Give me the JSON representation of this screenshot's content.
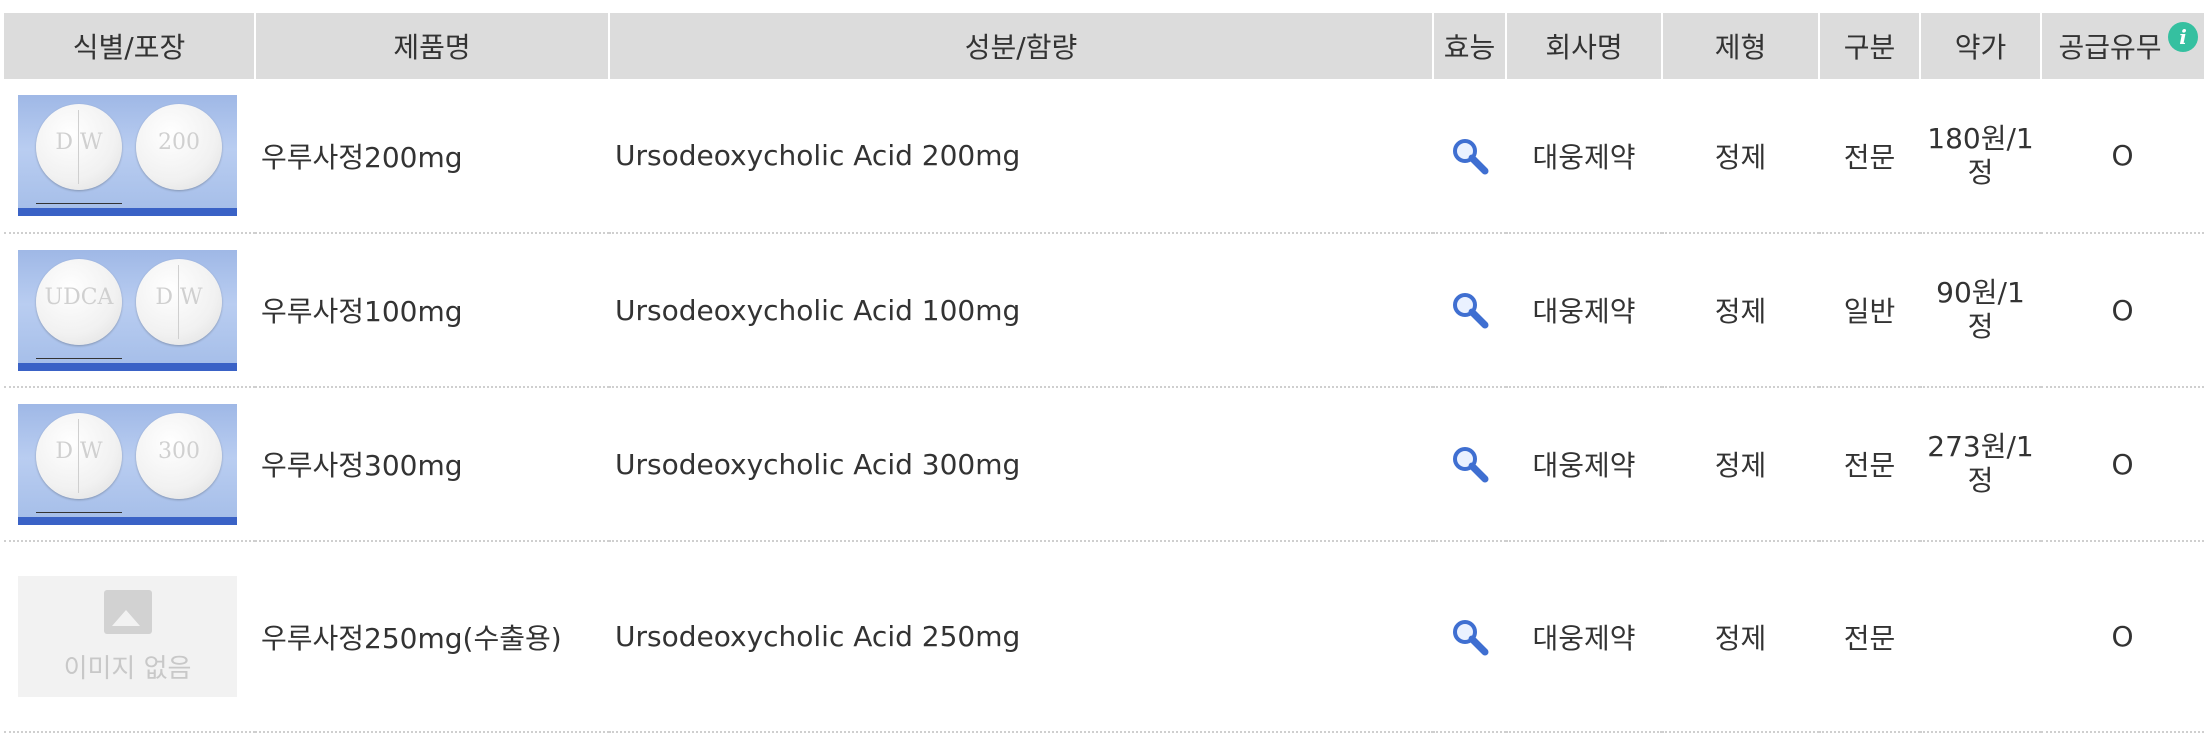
{
  "header": {
    "col_image": "식별/포장",
    "col_name": "제품명",
    "col_ingredient": "성분/함량",
    "col_effect": "효능",
    "col_company": "회사명",
    "col_form": "제형",
    "col_class": "구분",
    "col_price": "약가",
    "col_supply": "공급유무",
    "info_icon": "i"
  },
  "rows": [
    {
      "name": "우루사정200mg",
      "ingredient": "Ursodeoxycholic Acid 200mg",
      "company": "대웅제약",
      "form": "정제",
      "class": "전문",
      "price_line1": "180원/1",
      "price_line2": "정",
      "supply": "O",
      "image": {
        "mark_left": "D W",
        "mark_right": "200"
      }
    },
    {
      "name": "우루사정100mg",
      "ingredient": "Ursodeoxycholic Acid 100mg",
      "company": "대웅제약",
      "form": "정제",
      "class": "일반",
      "price_line1": "90원/1",
      "price_line2": "정",
      "supply": "O",
      "image": {
        "mark_left": "UDCA",
        "mark_right": "D W"
      }
    },
    {
      "name": "우루사정300mg",
      "ingredient": "Ursodeoxycholic Acid 300mg",
      "company": "대웅제약",
      "form": "정제",
      "class": "전문",
      "price_line1": "273원/1",
      "price_line2": "정",
      "supply": "O",
      "image": {
        "mark_left": "D W",
        "mark_right": "300"
      }
    },
    {
      "name": "우루사정250mg(수출용)",
      "ingredient": "Ursodeoxycholic Acid 250mg",
      "company": "대웅제약",
      "form": "정제",
      "class": "전문",
      "price_line1": "",
      "price_line2": "",
      "supply": "O",
      "image": {
        "no_image_text": "이미지 없음"
      }
    }
  ],
  "colors": {
    "header_bg": "#dcdcdc",
    "info_icon": "#35c0a0",
    "search_icon": "#3f6fd1"
  },
  "icons": {
    "effect": "search-icon",
    "info": "info-icon"
  }
}
